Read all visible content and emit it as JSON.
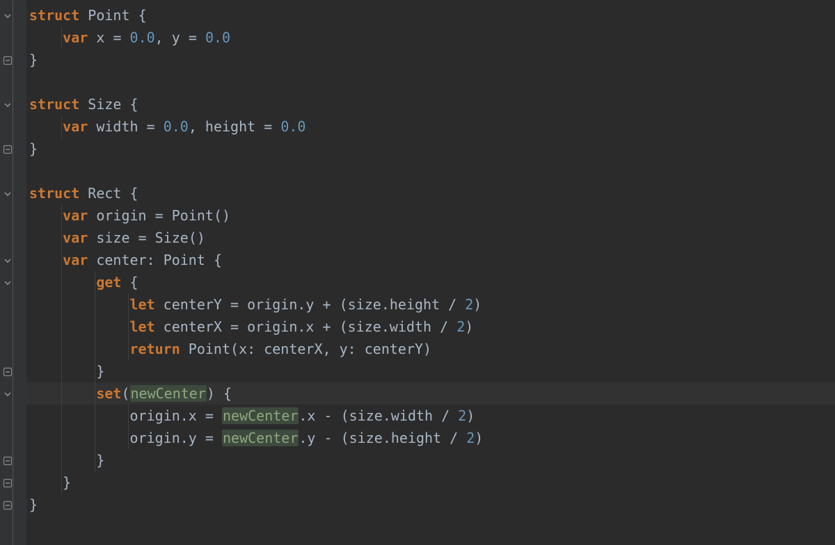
{
  "colors": {
    "bg": "#2b2b2b",
    "gutter": "#313335",
    "text": "#a9b7c6",
    "keyword": "#cc7832",
    "number": "#6897bb",
    "param": "#8fa881",
    "highlightLine": "#323232"
  },
  "fold_icons": {
    "open": "chevron-down-icon",
    "close": "minus-icon"
  },
  "code": {
    "lines": [
      {
        "fold": "open",
        "tokens": [
          [
            "kw",
            "struct"
          ],
          [
            "sp",
            " "
          ],
          [
            "type",
            "Point"
          ],
          [
            "sp",
            " "
          ],
          [
            "punc",
            "{"
          ]
        ]
      },
      {
        "fold": "",
        "indent": 1,
        "tokens": [
          [
            "pad",
            "    "
          ],
          [
            "kw",
            "var"
          ],
          [
            "sp",
            " "
          ],
          [
            "id",
            "x"
          ],
          [
            "sp",
            " "
          ],
          [
            "op",
            "="
          ],
          [
            "sp",
            " "
          ],
          [
            "num",
            "0.0"
          ],
          [
            "punc",
            ","
          ],
          [
            "sp",
            " "
          ],
          [
            "id",
            "y"
          ],
          [
            "sp",
            " "
          ],
          [
            "op",
            "="
          ],
          [
            "sp",
            " "
          ],
          [
            "num",
            "0.0"
          ]
        ]
      },
      {
        "fold": "close",
        "tokens": [
          [
            "punc",
            "}"
          ]
        ]
      },
      {
        "fold": "",
        "tokens": []
      },
      {
        "fold": "open",
        "tokens": [
          [
            "kw",
            "struct"
          ],
          [
            "sp",
            " "
          ],
          [
            "type",
            "Size"
          ],
          [
            "sp",
            " "
          ],
          [
            "punc",
            "{"
          ]
        ]
      },
      {
        "fold": "",
        "indent": 1,
        "tokens": [
          [
            "pad",
            "    "
          ],
          [
            "kw",
            "var"
          ],
          [
            "sp",
            " "
          ],
          [
            "id",
            "width"
          ],
          [
            "sp",
            " "
          ],
          [
            "op",
            "="
          ],
          [
            "sp",
            " "
          ],
          [
            "num",
            "0.0"
          ],
          [
            "punc",
            ","
          ],
          [
            "sp",
            " "
          ],
          [
            "id",
            "height"
          ],
          [
            "sp",
            " "
          ],
          [
            "op",
            "="
          ],
          [
            "sp",
            " "
          ],
          [
            "num",
            "0.0"
          ]
        ]
      },
      {
        "fold": "close",
        "tokens": [
          [
            "punc",
            "}"
          ]
        ]
      },
      {
        "fold": "",
        "tokens": []
      },
      {
        "fold": "open",
        "tokens": [
          [
            "kw",
            "struct"
          ],
          [
            "sp",
            " "
          ],
          [
            "type",
            "Rect"
          ],
          [
            "sp",
            " "
          ],
          [
            "punc",
            "{"
          ]
        ]
      },
      {
        "fold": "",
        "indent": 1,
        "tokens": [
          [
            "pad",
            "    "
          ],
          [
            "kw",
            "var"
          ],
          [
            "sp",
            " "
          ],
          [
            "id",
            "origin"
          ],
          [
            "sp",
            " "
          ],
          [
            "op",
            "="
          ],
          [
            "sp",
            " "
          ],
          [
            "type",
            "Point"
          ],
          [
            "punc",
            "()"
          ]
        ]
      },
      {
        "fold": "",
        "indent": 1,
        "tokens": [
          [
            "pad",
            "    "
          ],
          [
            "kw",
            "var"
          ],
          [
            "sp",
            " "
          ],
          [
            "id",
            "size"
          ],
          [
            "sp",
            " "
          ],
          [
            "op",
            "="
          ],
          [
            "sp",
            " "
          ],
          [
            "type",
            "Size"
          ],
          [
            "punc",
            "()"
          ]
        ]
      },
      {
        "fold": "open",
        "indent": 1,
        "tokens": [
          [
            "pad",
            "    "
          ],
          [
            "kw",
            "var"
          ],
          [
            "sp",
            " "
          ],
          [
            "id",
            "center"
          ],
          [
            "punc",
            ":"
          ],
          [
            "sp",
            " "
          ],
          [
            "type",
            "Point"
          ],
          [
            "sp",
            " "
          ],
          [
            "punc",
            "{"
          ]
        ]
      },
      {
        "fold": "open",
        "indent": 2,
        "tokens": [
          [
            "pad",
            "        "
          ],
          [
            "kw2",
            "get"
          ],
          [
            "sp",
            " "
          ],
          [
            "punc",
            "{"
          ]
        ]
      },
      {
        "fold": "",
        "indent": 3,
        "tokens": [
          [
            "pad",
            "            "
          ],
          [
            "kw",
            "let"
          ],
          [
            "sp",
            " "
          ],
          [
            "id",
            "centerY"
          ],
          [
            "sp",
            " "
          ],
          [
            "op",
            "="
          ],
          [
            "sp",
            " "
          ],
          [
            "id",
            "origin"
          ],
          [
            "punc",
            "."
          ],
          [
            "id",
            "y"
          ],
          [
            "sp",
            " "
          ],
          [
            "op",
            "+"
          ],
          [
            "sp",
            " "
          ],
          [
            "punc",
            "("
          ],
          [
            "id",
            "size"
          ],
          [
            "punc",
            "."
          ],
          [
            "id",
            "height"
          ],
          [
            "sp",
            " "
          ],
          [
            "op",
            "/"
          ],
          [
            "sp",
            " "
          ],
          [
            "num",
            "2"
          ],
          [
            "punc",
            ")"
          ]
        ]
      },
      {
        "fold": "",
        "indent": 3,
        "tokens": [
          [
            "pad",
            "            "
          ],
          [
            "kw",
            "let"
          ],
          [
            "sp",
            " "
          ],
          [
            "id",
            "centerX"
          ],
          [
            "sp",
            " "
          ],
          [
            "op",
            "="
          ],
          [
            "sp",
            " "
          ],
          [
            "id",
            "origin"
          ],
          [
            "punc",
            "."
          ],
          [
            "id",
            "x"
          ],
          [
            "sp",
            " "
          ],
          [
            "op",
            "+"
          ],
          [
            "sp",
            " "
          ],
          [
            "punc",
            "("
          ],
          [
            "id",
            "size"
          ],
          [
            "punc",
            "."
          ],
          [
            "id",
            "width"
          ],
          [
            "sp",
            " "
          ],
          [
            "op",
            "/"
          ],
          [
            "sp",
            " "
          ],
          [
            "num",
            "2"
          ],
          [
            "punc",
            ")"
          ]
        ]
      },
      {
        "fold": "",
        "indent": 3,
        "tokens": [
          [
            "pad",
            "            "
          ],
          [
            "kw",
            "return"
          ],
          [
            "sp",
            " "
          ],
          [
            "type",
            "Point"
          ],
          [
            "punc",
            "("
          ],
          [
            "id",
            "x"
          ],
          [
            "punc",
            ":"
          ],
          [
            "sp",
            " "
          ],
          [
            "id",
            "centerX"
          ],
          [
            "punc",
            ","
          ],
          [
            "sp",
            " "
          ],
          [
            "id",
            "y"
          ],
          [
            "punc",
            ":"
          ],
          [
            "sp",
            " "
          ],
          [
            "id",
            "centerY"
          ],
          [
            "punc",
            ")"
          ]
        ]
      },
      {
        "fold": "close",
        "indent": 2,
        "tokens": [
          [
            "pad",
            "        "
          ],
          [
            "punc",
            "}"
          ]
        ]
      },
      {
        "fold": "open",
        "indent": 2,
        "hl": true,
        "tokens": [
          [
            "pad",
            "        "
          ],
          [
            "kw2",
            "set"
          ],
          [
            "punc",
            "("
          ],
          [
            "parambg",
            "newCenter"
          ],
          [
            "punc",
            ")"
          ],
          [
            "sp",
            " "
          ],
          [
            "punc",
            "{"
          ]
        ]
      },
      {
        "fold": "",
        "indent": 3,
        "tokens": [
          [
            "pad",
            "            "
          ],
          [
            "id",
            "origin"
          ],
          [
            "punc",
            "."
          ],
          [
            "id",
            "x"
          ],
          [
            "sp",
            " "
          ],
          [
            "op",
            "="
          ],
          [
            "sp",
            " "
          ],
          [
            "parambg",
            "newCenter"
          ],
          [
            "punc",
            "."
          ],
          [
            "id",
            "x"
          ],
          [
            "sp",
            " "
          ],
          [
            "op",
            "-"
          ],
          [
            "sp",
            " "
          ],
          [
            "punc",
            "("
          ],
          [
            "id",
            "size"
          ],
          [
            "punc",
            "."
          ],
          [
            "id",
            "width"
          ],
          [
            "sp",
            " "
          ],
          [
            "op",
            "/"
          ],
          [
            "sp",
            " "
          ],
          [
            "num",
            "2"
          ],
          [
            "punc",
            ")"
          ]
        ]
      },
      {
        "fold": "",
        "indent": 3,
        "tokens": [
          [
            "pad",
            "            "
          ],
          [
            "id",
            "origin"
          ],
          [
            "punc",
            "."
          ],
          [
            "id",
            "y"
          ],
          [
            "sp",
            " "
          ],
          [
            "op",
            "="
          ],
          [
            "sp",
            " "
          ],
          [
            "parambg",
            "newCenter"
          ],
          [
            "punc",
            "."
          ],
          [
            "id",
            "y"
          ],
          [
            "sp",
            " "
          ],
          [
            "op",
            "-"
          ],
          [
            "sp",
            " "
          ],
          [
            "punc",
            "("
          ],
          [
            "id",
            "size"
          ],
          [
            "punc",
            "."
          ],
          [
            "id",
            "height"
          ],
          [
            "sp",
            " "
          ],
          [
            "op",
            "/"
          ],
          [
            "sp",
            " "
          ],
          [
            "num",
            "2"
          ],
          [
            "punc",
            ")"
          ]
        ]
      },
      {
        "fold": "close",
        "indent": 2,
        "tokens": [
          [
            "pad",
            "        "
          ],
          [
            "punc",
            "}"
          ]
        ]
      },
      {
        "fold": "close",
        "indent": 1,
        "tokens": [
          [
            "pad",
            "    "
          ],
          [
            "punc",
            "}"
          ]
        ]
      },
      {
        "fold": "close",
        "tokens": [
          [
            "punc",
            "}"
          ]
        ]
      }
    ]
  }
}
